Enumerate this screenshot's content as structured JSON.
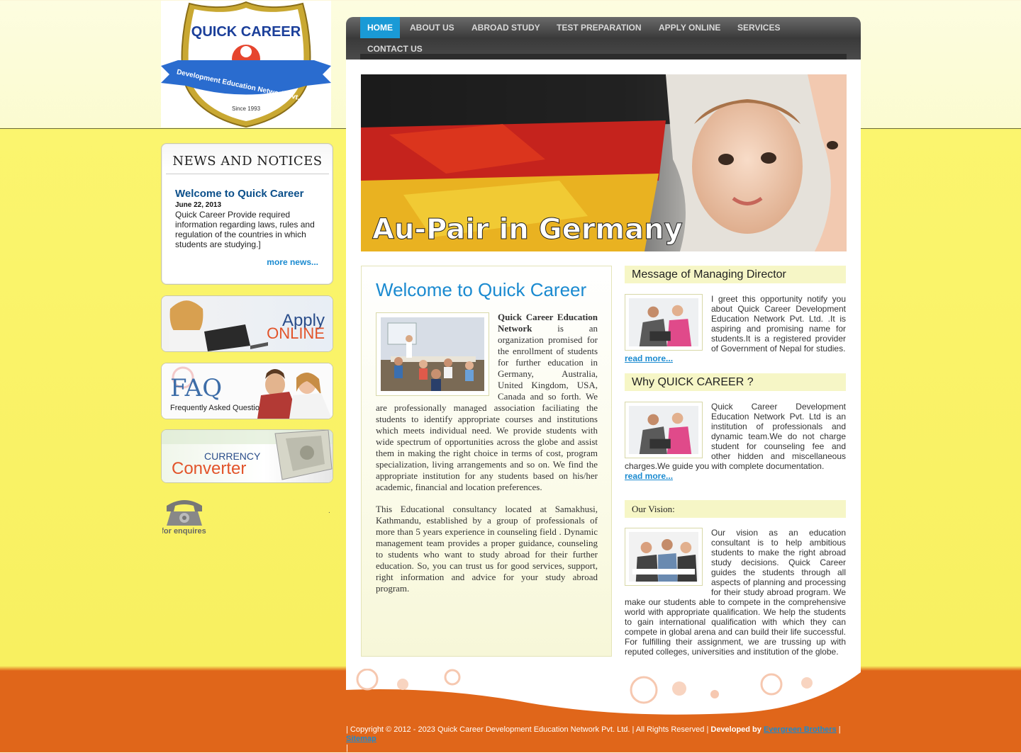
{
  "logo": {
    "line1": "QUICK CAREER",
    "line2": "Development Education Network Pvt. Ltd.",
    "line3": "Since 1993"
  },
  "nav": {
    "items": [
      "HOME",
      "ABOUT US",
      "ABROAD STUDY",
      "TEST PREPARATION",
      "APPLY ONLINE",
      "SERVICES",
      "CONTACT US"
    ],
    "active": "HOME"
  },
  "banner": {
    "caption": "Au-Pair in Germany"
  },
  "news": {
    "heading": "NEWS AND NOTICES",
    "title": "Welcome to Quick Career",
    "date": "June 22, 2013",
    "body": "Quick Career Provide required information regarding laws, rules and regulation of the countries in which students are studying.]",
    "more": "more news..."
  },
  "promos": {
    "apply": {
      "line1": "Apply",
      "line2": "ONLINE"
    },
    "faq": {
      "line1": "FAQ",
      "line2": "Frequently Asked Questions"
    },
    "currency": {
      "line1": "CURRENCY",
      "line2": "Converter"
    },
    "enquiry": {
      "label": "for enquires",
      "dot": "."
    }
  },
  "welcome": {
    "title": "Welcome to Quick Career",
    "lead_bold": "Quick Career Education Network",
    "para1": " is an organization promised for the enrollment of students for further education in Germany, Australia, United Kingdom, USA, Canada and so forth. We are professionally managed association faciliating the students to identify appropriate courses and institutions which meets individual need. We provide students with wide spectrum of opportunities across the globe and assist them in making the right choice in terms of cost, program specialization, living arrangements and so on. We find the appropriate institution for any students based on his/her academic, financial and location preferences.",
    "para2": "This Educational consultancy located at Samakhusi, Kathmandu, established by a group of professionals of more than 5 years experience in counseling field . Dynamic management team provides a proper guidance, counseling to students who want to study abroad for their further education. So, you can trust us for good services, support, right information and advice for your study abroad program."
  },
  "director": {
    "heading": "Message of Managing Director",
    "text": "I greet this opportunity notify you about Quick Career Development Education Network Pvt. Ltd. .It is aspiring and promising name for students.It is a registered provider of Government of Nepal for studies.",
    "more": "read more..."
  },
  "why": {
    "heading": "Why QUICK CAREER ?",
    "text": "Quick Career Development Education Network Pvt. Ltd is an institution of professionals and dynamic team.We do not charge student for counseling fee and other hidden and miscellaneous charges.We guide you with complete documentation.",
    "more": "read more..."
  },
  "vision": {
    "heading": "Our Vision:",
    "text": "Our vision as an education consultant is to help ambitious students to make the right abroad study decisions. Quick Career guides the students through all aspects of planning and processing for their study abroad program. We make our students able to compete in the comprehensive world with appropriate qualification. We help the students to gain international qualification with which they can compete in global arena and can build their life successful. For fulfilling their assignment, we are trussing up with reputed colleges, universities and institution of the globe."
  },
  "footer": {
    "copyright": "| Copyright © 2012 - 2023 Quick Career Development Education Network Pvt. Ltd. | All Rights Reserved |",
    "developed_by": "Developed by",
    "developer": "Evergreen Brothers",
    "sep": "|",
    "sitemap": "Sitemap",
    "tail": "|"
  },
  "colors": {
    "accent": "#1a9ad6",
    "heading_blue": "#0b4f8a",
    "footer_orange": "#e0661a",
    "bg_yellow": "#f8f060"
  }
}
